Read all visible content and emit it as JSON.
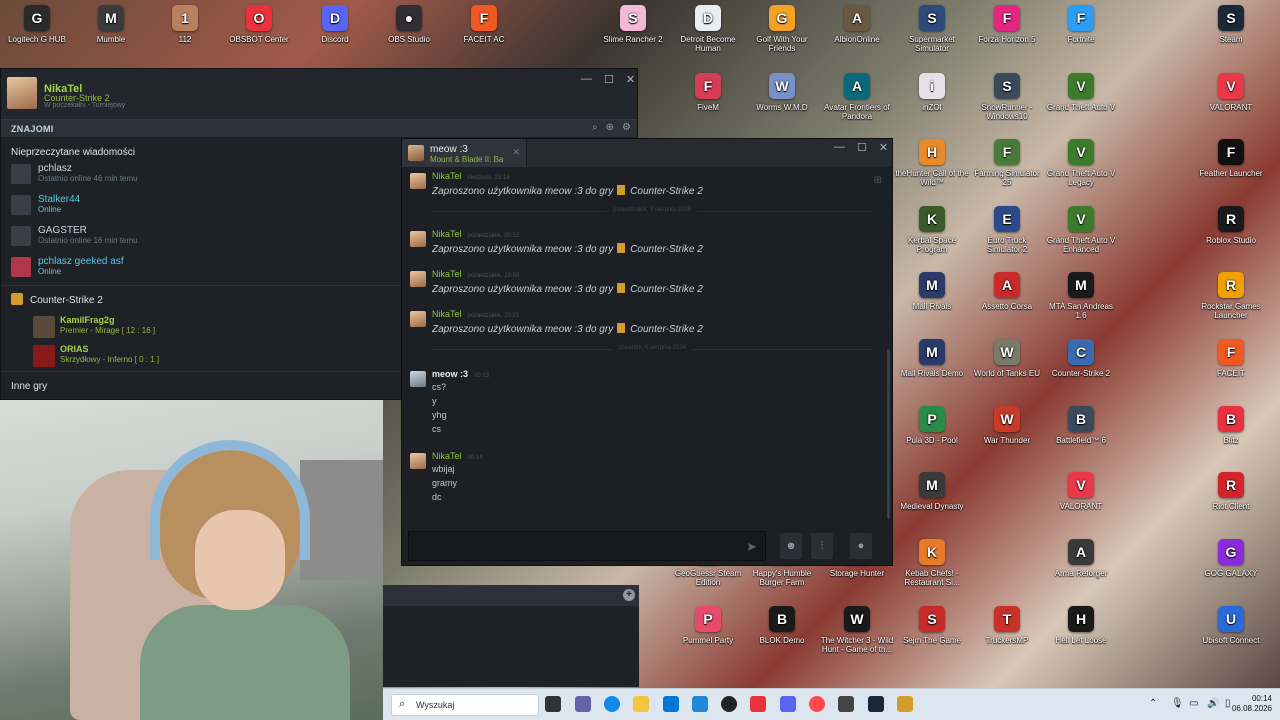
{
  "desktop": {
    "icons_top": [
      {
        "label": "Logitech G HUB",
        "color": "#2b2b2b",
        "glyph": "G"
      },
      {
        "label": "Mumble",
        "color": "#3b3b3b",
        "glyph": "M"
      },
      {
        "label": "112",
        "color": "#b98060",
        "glyph": "1"
      },
      {
        "label": "OBSBOT Center",
        "color": "#e8323c",
        "glyph": "O"
      },
      {
        "label": "Discord",
        "color": "#5865f2",
        "glyph": "D"
      },
      {
        "label": "OBS Studio",
        "color": "#302e31",
        "glyph": "●"
      },
      {
        "label": "FACEIT AC",
        "color": "#f05a22",
        "glyph": "F"
      },
      {
        "label": "Slime Rancher 2",
        "color": "#f5b9d8",
        "glyph": "S"
      },
      {
        "label": "Detroit Become Human",
        "color": "#e8eef4",
        "glyph": "D"
      },
      {
        "label": "Golf With Your Friends",
        "color": "#f3a224",
        "glyph": "G"
      },
      {
        "label": "AlbionOnline",
        "color": "#6a5840",
        "glyph": "A"
      },
      {
        "label": "Supermarket Simulator",
        "color": "#2c4a7a",
        "glyph": "S"
      },
      {
        "label": "Forza Horizon 5",
        "color": "#e42680",
        "glyph": "F"
      },
      {
        "label": "Fortnite",
        "color": "#2a9df4",
        "glyph": "F"
      },
      {
        "label": "Steam",
        "color": "#1b2838",
        "glyph": "S"
      }
    ],
    "icons_right": [
      {
        "label": "FiveM",
        "color": "#d63c56",
        "glyph": "F"
      },
      {
        "label": "Worms W.M.D",
        "color": "#7a90c8",
        "glyph": "W"
      },
      {
        "label": "Avatar Frontiers of Pandora",
        "color": "#0a6a7a",
        "glyph": "A"
      },
      {
        "label": "inZOI",
        "color": "#e8e0e8",
        "glyph": "i"
      },
      {
        "label": "SnowRunner - Windows10",
        "color": "#3a4a5a",
        "glyph": "S"
      },
      {
        "label": "Grand Theft Auto V",
        "color": "#3c7a2c",
        "glyph": "V"
      },
      {
        "label": "VALORANT",
        "color": "#e8384a",
        "glyph": "V"
      },
      {
        "label": "theHunter Call of the Wild™",
        "color": "#e8892a",
        "glyph": "H"
      },
      {
        "label": "Farming Simulator 25",
        "color": "#4a7a3a",
        "glyph": "F"
      },
      {
        "label": "Grand Theft Auto V Legacy",
        "color": "#3c7a2c",
        "glyph": "V"
      },
      {
        "label": "Feather Launcher",
        "color": "#111111",
        "glyph": "F"
      },
      {
        "label": "Kerbal Space Program",
        "color": "#3a5a2a",
        "glyph": "K"
      },
      {
        "label": "Euro Truck Simulator 2",
        "color": "#2a4a8a",
        "glyph": "E"
      },
      {
        "label": "Grand Theft Auto V Enhanced",
        "color": "#3c7a2c",
        "glyph": "V"
      },
      {
        "label": "Roblox Studio",
        "color": "#1a1a1a",
        "glyph": "R"
      },
      {
        "label": "Mall Rivals",
        "color": "#2a3a6a",
        "glyph": "M"
      },
      {
        "label": "Assetto Corsa",
        "color": "#c82a2a",
        "glyph": "A"
      },
      {
        "label": "MTA San Andreas 1.6",
        "color": "#1a1a1a",
        "glyph": "M"
      },
      {
        "label": "Rockstar Games Launcher",
        "color": "#f0a000",
        "glyph": "R"
      },
      {
        "label": "Mall Rivals Demo",
        "color": "#2a3a6a",
        "glyph": "M"
      },
      {
        "label": "World of Tanks EU",
        "color": "#7a7a6a",
        "glyph": "W"
      },
      {
        "label": "Counter-Strike 2",
        "color": "#3a6ab0",
        "glyph": "C"
      },
      {
        "label": "FACEIT",
        "color": "#f05a22",
        "glyph": "F"
      },
      {
        "label": "Pula 3D - Pool",
        "color": "#2a8a4a",
        "glyph": "P"
      },
      {
        "label": "War Thunder",
        "color": "#c83a2a",
        "glyph": "W"
      },
      {
        "label": "Battlefield™ 6",
        "color": "#3a4a5a",
        "glyph": "B"
      },
      {
        "label": "Blitz",
        "color": "#e83040",
        "glyph": "B"
      },
      {
        "label": "Medieval Dynasty",
        "color": "#3a3a3a",
        "glyph": "M"
      },
      {
        "label": "VALORANT",
        "color": "#e8384a",
        "glyph": "V"
      },
      {
        "label": "Riot Client",
        "color": "#d4232a",
        "glyph": "R"
      },
      {
        "label": "GeoGuessr Steam Edition",
        "color": "#4a2a8a",
        "glyph": "G"
      },
      {
        "label": "Happy's Humble Burger Farm",
        "color": "#e8b040",
        "glyph": "H"
      },
      {
        "label": "Storage Hunter",
        "color": "#6a6a6a",
        "glyph": "S"
      },
      {
        "label": "Kebab Chefs! - Restaurant Si...",
        "color": "#e87a2a",
        "glyph": "K"
      },
      {
        "label": "Arma Reforger",
        "color": "#3a3a3a",
        "glyph": "A"
      },
      {
        "label": "GOG GALAXY",
        "color": "#8a2ad8",
        "glyph": "G"
      },
      {
        "label": "Pummel Party",
        "color": "#e84a6a",
        "glyph": "P"
      },
      {
        "label": "BLOK Demo",
        "color": "#1a1a1a",
        "glyph": "B"
      },
      {
        "label": "The Witcher 3 - Wild Hunt - Game of th...",
        "color": "#1a1a1a",
        "glyph": "W"
      },
      {
        "label": "Sejm The Game",
        "color": "#c82a2a",
        "glyph": "S"
      },
      {
        "label": "TruckersMP",
        "color": "#c8302a",
        "glyph": "T"
      },
      {
        "label": "Hell Let Loose",
        "color": "#1a1a1a",
        "glyph": "H"
      },
      {
        "label": "Ubisoft Connect",
        "color": "#2a6ad8",
        "glyph": "U"
      }
    ]
  },
  "friends_window": {
    "user": {
      "name": "NikaTel",
      "game": "Counter-Strike 2",
      "sub": "W poczekalni - Turniejowy"
    },
    "header": "ZNAJOMI",
    "unread_title": "Nieprzeczytane wiadomości",
    "friends": [
      {
        "name": "pchlasz",
        "status": "Ostatnio online 46 min temu"
      },
      {
        "name": "Stalker44",
        "status": "Online"
      },
      {
        "name": "GAGSTER",
        "status": "Ostatnio online 16 min temu"
      },
      {
        "name": "pchlasz geeked asf",
        "status": "Online"
      }
    ],
    "game_group": "Counter-Strike 2",
    "ingame": [
      {
        "name": "KamilFrag2g",
        "status": "Premier - Mirage [ 12 : 16 ]"
      },
      {
        "name": "ORIAS",
        "status": "Skrzydłowy - Inferno [ 0 : 1 ]"
      }
    ],
    "other_games": "Inne gry"
  },
  "chat_window": {
    "tab": {
      "name": "meow :3",
      "game": "Mount & Blade II: Ba"
    },
    "messages": [
      {
        "author": "NikaTel",
        "time": "niedziela, 23:18",
        "invite": "Zaproszono użytkownika meow :3 do gry",
        "game": "Counter-Strike 2"
      },
      {
        "author": "NikaTel",
        "time": "poniedziałek, 00:53",
        "invite": "Zaproszono użytkownika meow :3 do gry",
        "game": "Counter-Strike 2"
      },
      {
        "author": "NikaTel",
        "time": "poniedziałek, 19:59",
        "invite": "Zaproszono użytkownika meow :3 do gry",
        "game": "Counter-Strike 2"
      },
      {
        "author": "NikaTel",
        "time": "poniedziałek, 20:21",
        "invite": "Zaproszono użytkownika meow :3 do gry",
        "game": "Counter-Strike 2"
      }
    ],
    "day_sep_1": "poniedziałek, 3 sierpnia 2026",
    "day_sep_2": "czwartek, 6 sierpnia 2026",
    "meow_msg": {
      "author": "meow :3",
      "time": "00:13",
      "lines": [
        "cs?",
        "y",
        "yhg",
        "cs"
      ]
    },
    "nika_msg": {
      "author": "NikaTel",
      "time": "00:14",
      "lines": [
        "wbijaj",
        "gramy",
        "dc"
      ]
    }
  },
  "taskbar": {
    "search_placeholder": "Wyszukaj",
    "time": "00:14",
    "date": "06.08.2026"
  }
}
